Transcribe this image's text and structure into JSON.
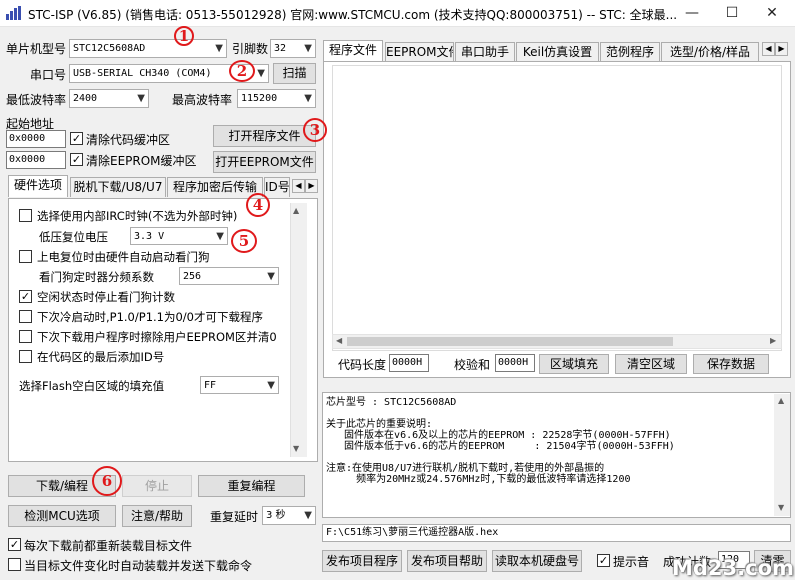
{
  "window": {
    "title": "STC-ISP (V6.85) (销售电话: 0513-55012928) 官网:www.STCMCU.com  (技术支持QQ:800003751)  -- STC: 全球最...",
    "minimize": "—",
    "maximize": "☐",
    "close": "✕"
  },
  "left": {
    "mcu_label": "单片机型号",
    "mcu_value": "STC12C5608AD",
    "pin_label": "引脚数",
    "pin_value": "32",
    "port_label": "串口号",
    "port_value": "USB-SERIAL CH340 (COM4)",
    "scan_button": "扫描",
    "min_baud_label": "最低波特率",
    "min_baud_value": "2400",
    "max_baud_label": "最高波特率",
    "max_baud_value": "115200",
    "start_addr_label": "起始地址",
    "addr1_value": "0x0000",
    "clear_code_label": "清除代码缓冲区",
    "open_program_button": "打开程序文件",
    "addr2_value": "0x0000",
    "clear_eeprom_label": "清除EEPROM缓冲区",
    "open_eeprom_button": "打开EEPROM文件"
  },
  "left_tabs": [
    "硬件选项",
    "脱机下载/U8/U7",
    "程序加密后传输",
    "ID号"
  ],
  "hardware_options": {
    "opt1": "选择使用内部IRC时钟(不选为外部时钟)",
    "low_voltage_label": "低压复位电压",
    "low_voltage_value": "3.3 V",
    "opt2": "上电复位时由硬件自动启动看门狗",
    "watchdog_label": "看门狗定时器分频系数",
    "watchdog_value": "256",
    "opt3": "空闲状态时停止看门狗计数",
    "opt4": "下次冷启动时,P1.0/P1.1为0/0才可下载程序",
    "opt5": "下次下载用户程序时擦除用户EEPROM区并清0",
    "opt6": "在代码区的最后添加ID号",
    "fill_label": "选择Flash空白区域的填充值",
    "fill_value": "FF"
  },
  "checks": {
    "clear_code": true,
    "clear_eeprom": true,
    "opt1": false,
    "opt2": false,
    "opt3": true,
    "opt4": false,
    "opt5": false,
    "opt6": false,
    "reload_before_download": true,
    "auto_reload_on_change": false,
    "beep": true
  },
  "bottom_left": {
    "download_button": "下载/编程",
    "stop_button": "停止",
    "reprogram_button": "重复编程",
    "detect_button": "检测MCU选项",
    "help_button": "注意/帮助",
    "repeat_delay_label": "重复延时",
    "repeat_delay_value": "3 秒",
    "reload_before_download": "每次下载前都重新装载目标文件",
    "auto_reload_on_change": "当目标文件变化时自动装载并发送下载命令"
  },
  "right_tabs": [
    "程序文件",
    "EEPROM文件",
    "串口助手",
    "Keil仿真设置",
    "范例程序",
    "选型/价格/样品"
  ],
  "code_bar": {
    "code_length_label": "代码长度",
    "code_length_value": "0000H",
    "checksum_label": "校验和",
    "checksum_value": "0000H",
    "fill_area_button": "区域填充",
    "clear_area_button": "清空区域",
    "save_data_button": "保存数据"
  },
  "info_text": "芯片型号 : STC12C5608AD\n\n关于此芯片的重要说明:\n   固件版本在v6.6及以上的芯片的EEPROM : 22528字节(0000H-57FFH)\n   固件版本低于v6.6的芯片的EEPROM     : 21504字节(0000H-53FFH)\n\n注意:在使用U8/U7进行联机/脱机下载时,若使用的外部晶振的\n     频率为20MHz或24.576MHz时,下载的最低波特率请选择1200",
  "file_path": "F:\\C51练习\\萝丽三代遥控器A版.hex",
  "bottom_right": {
    "publish_project_button": "发布项目程序",
    "publish_help_button": "发布项目帮助",
    "read_disk_button": "读取本机硬盘号",
    "beep_label": "提示音",
    "success_count_label": "成功计数",
    "success_count_value": "120",
    "clear_button": "清零"
  },
  "annotations": [
    "1",
    "2",
    "3",
    "4",
    "5",
    "6"
  ],
  "watermark": "Md23.com"
}
